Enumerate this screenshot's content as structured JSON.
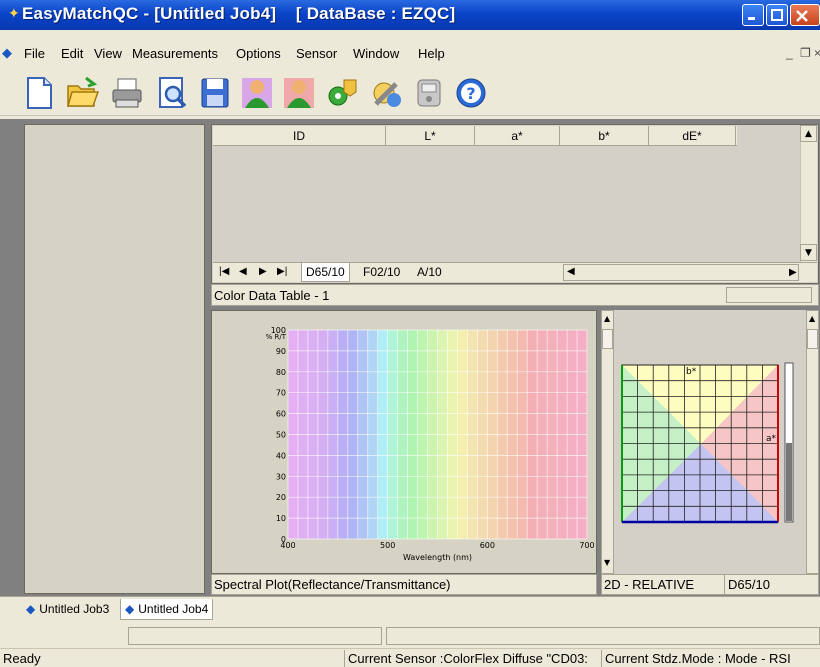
{
  "window": {
    "app_name": "EasyMatchQC",
    "title": "EasyMatchQC - [Untitled Job4]    [ DataBase : EZQC]",
    "colors": {
      "titlebar": "#0a44c8",
      "client_bg": "#808080",
      "pane_bg": "#d6d3c4"
    }
  },
  "menu": [
    "File",
    "Edit",
    "View",
    "Measurements",
    "Options",
    "Sensor",
    "Window",
    "Help"
  ],
  "toolbar": {
    "buttons": [
      "new-document-icon",
      "open-folder-icon",
      "print-icon",
      "print-preview-icon",
      "save-disk-icon",
      "standard-icon",
      "sample-icon",
      "product-setup-icon",
      "tools-icon",
      "sensor-icon",
      "help-icon"
    ]
  },
  "grid": {
    "columns": [
      "ID",
      "L*",
      "a*",
      "b*",
      "dE*"
    ],
    "rows": [],
    "sheets": [
      "D65/10",
      "F02/10",
      "A/10"
    ],
    "active_sheet": "D65/10",
    "caption": "Color Data Table - 1"
  },
  "plot": {
    "caption": "Spectral Plot(Reflectance/Transmittance)"
  },
  "chart_data": {
    "type": "line",
    "title": "",
    "xlabel": "Wavelength (nm)",
    "ylabel": "% R/T",
    "xlim": [
      400,
      700
    ],
    "ylim": [
      0,
      100
    ],
    "x_ticks": [
      400,
      500,
      600,
      700
    ],
    "y_ticks": [
      0,
      10,
      20,
      30,
      40,
      50,
      60,
      70,
      80,
      90,
      100
    ],
    "grid": true,
    "series": []
  },
  "plot2d": {
    "axis_b": "b*",
    "axis_a": "a*",
    "mode": "2D - RELATIVE",
    "illuminant": "D65/10",
    "colors": {
      "green_zone": "#c5f0c5",
      "yellow_zone": "#fffcc0",
      "red_zone": "#f6c5c5",
      "blue_zone": "#c4c4f2",
      "red_axis": "#d00000",
      "green_axis": "#00a000",
      "blue_axis": "#0000a0"
    }
  },
  "doc_tabs": [
    {
      "label": "Untitled Job3",
      "active": false
    },
    {
      "label": "Untitled Job4",
      "active": true
    }
  ],
  "status": {
    "ready": "Ready",
    "sensor": "Current Sensor :ColorFlex Diffuse \"CD03:",
    "stdz": "Current Stdz.Mode :  Mode - RSI"
  }
}
